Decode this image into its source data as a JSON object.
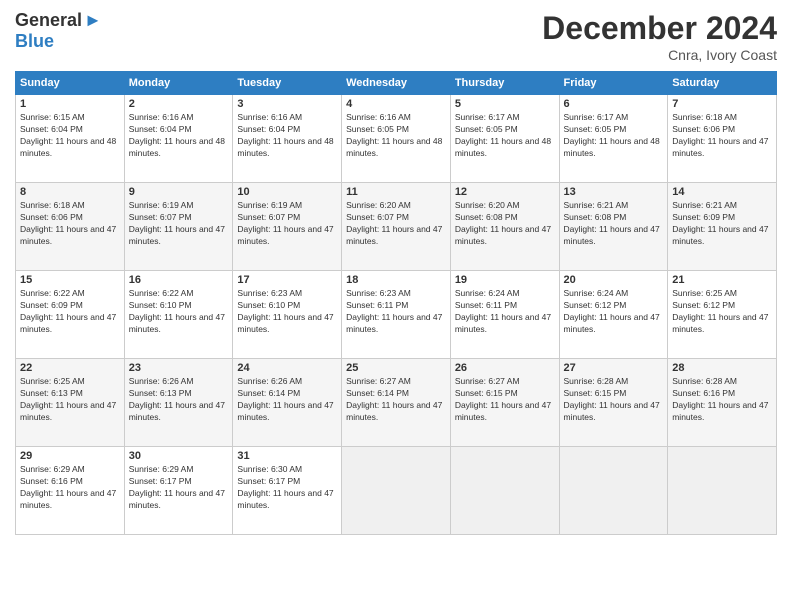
{
  "logo": {
    "general": "General",
    "blue": "Blue"
  },
  "title": "December 2024",
  "location": "Cnra, Ivory Coast",
  "weekdays": [
    "Sunday",
    "Monday",
    "Tuesday",
    "Wednesday",
    "Thursday",
    "Friday",
    "Saturday"
  ],
  "weeks": [
    [
      {
        "day": "1",
        "sunrise": "6:15 AM",
        "sunset": "6:04 PM",
        "daylight": "11 hours and 48 minutes."
      },
      {
        "day": "2",
        "sunrise": "6:16 AM",
        "sunset": "6:04 PM",
        "daylight": "11 hours and 48 minutes."
      },
      {
        "day": "3",
        "sunrise": "6:16 AM",
        "sunset": "6:04 PM",
        "daylight": "11 hours and 48 minutes."
      },
      {
        "day": "4",
        "sunrise": "6:16 AM",
        "sunset": "6:05 PM",
        "daylight": "11 hours and 48 minutes."
      },
      {
        "day": "5",
        "sunrise": "6:17 AM",
        "sunset": "6:05 PM",
        "daylight": "11 hours and 48 minutes."
      },
      {
        "day": "6",
        "sunrise": "6:17 AM",
        "sunset": "6:05 PM",
        "daylight": "11 hours and 48 minutes."
      },
      {
        "day": "7",
        "sunrise": "6:18 AM",
        "sunset": "6:06 PM",
        "daylight": "11 hours and 47 minutes."
      }
    ],
    [
      {
        "day": "8",
        "sunrise": "6:18 AM",
        "sunset": "6:06 PM",
        "daylight": "11 hours and 47 minutes."
      },
      {
        "day": "9",
        "sunrise": "6:19 AM",
        "sunset": "6:07 PM",
        "daylight": "11 hours and 47 minutes."
      },
      {
        "day": "10",
        "sunrise": "6:19 AM",
        "sunset": "6:07 PM",
        "daylight": "11 hours and 47 minutes."
      },
      {
        "day": "11",
        "sunrise": "6:20 AM",
        "sunset": "6:07 PM",
        "daylight": "11 hours and 47 minutes."
      },
      {
        "day": "12",
        "sunrise": "6:20 AM",
        "sunset": "6:08 PM",
        "daylight": "11 hours and 47 minutes."
      },
      {
        "day": "13",
        "sunrise": "6:21 AM",
        "sunset": "6:08 PM",
        "daylight": "11 hours and 47 minutes."
      },
      {
        "day": "14",
        "sunrise": "6:21 AM",
        "sunset": "6:09 PM",
        "daylight": "11 hours and 47 minutes."
      }
    ],
    [
      {
        "day": "15",
        "sunrise": "6:22 AM",
        "sunset": "6:09 PM",
        "daylight": "11 hours and 47 minutes."
      },
      {
        "day": "16",
        "sunrise": "6:22 AM",
        "sunset": "6:10 PM",
        "daylight": "11 hours and 47 minutes."
      },
      {
        "day": "17",
        "sunrise": "6:23 AM",
        "sunset": "6:10 PM",
        "daylight": "11 hours and 47 minutes."
      },
      {
        "day": "18",
        "sunrise": "6:23 AM",
        "sunset": "6:11 PM",
        "daylight": "11 hours and 47 minutes."
      },
      {
        "day": "19",
        "sunrise": "6:24 AM",
        "sunset": "6:11 PM",
        "daylight": "11 hours and 47 minutes."
      },
      {
        "day": "20",
        "sunrise": "6:24 AM",
        "sunset": "6:12 PM",
        "daylight": "11 hours and 47 minutes."
      },
      {
        "day": "21",
        "sunrise": "6:25 AM",
        "sunset": "6:12 PM",
        "daylight": "11 hours and 47 minutes."
      }
    ],
    [
      {
        "day": "22",
        "sunrise": "6:25 AM",
        "sunset": "6:13 PM",
        "daylight": "11 hours and 47 minutes."
      },
      {
        "day": "23",
        "sunrise": "6:26 AM",
        "sunset": "6:13 PM",
        "daylight": "11 hours and 47 minutes."
      },
      {
        "day": "24",
        "sunrise": "6:26 AM",
        "sunset": "6:14 PM",
        "daylight": "11 hours and 47 minutes."
      },
      {
        "day": "25",
        "sunrise": "6:27 AM",
        "sunset": "6:14 PM",
        "daylight": "11 hours and 47 minutes."
      },
      {
        "day": "26",
        "sunrise": "6:27 AM",
        "sunset": "6:15 PM",
        "daylight": "11 hours and 47 minutes."
      },
      {
        "day": "27",
        "sunrise": "6:28 AM",
        "sunset": "6:15 PM",
        "daylight": "11 hours and 47 minutes."
      },
      {
        "day": "28",
        "sunrise": "6:28 AM",
        "sunset": "6:16 PM",
        "daylight": "11 hours and 47 minutes."
      }
    ],
    [
      {
        "day": "29",
        "sunrise": "6:29 AM",
        "sunset": "6:16 PM",
        "daylight": "11 hours and 47 minutes."
      },
      {
        "day": "30",
        "sunrise": "6:29 AM",
        "sunset": "6:17 PM",
        "daylight": "11 hours and 47 minutes."
      },
      {
        "day": "31",
        "sunrise": "6:30 AM",
        "sunset": "6:17 PM",
        "daylight": "11 hours and 47 minutes."
      },
      null,
      null,
      null,
      null
    ]
  ]
}
